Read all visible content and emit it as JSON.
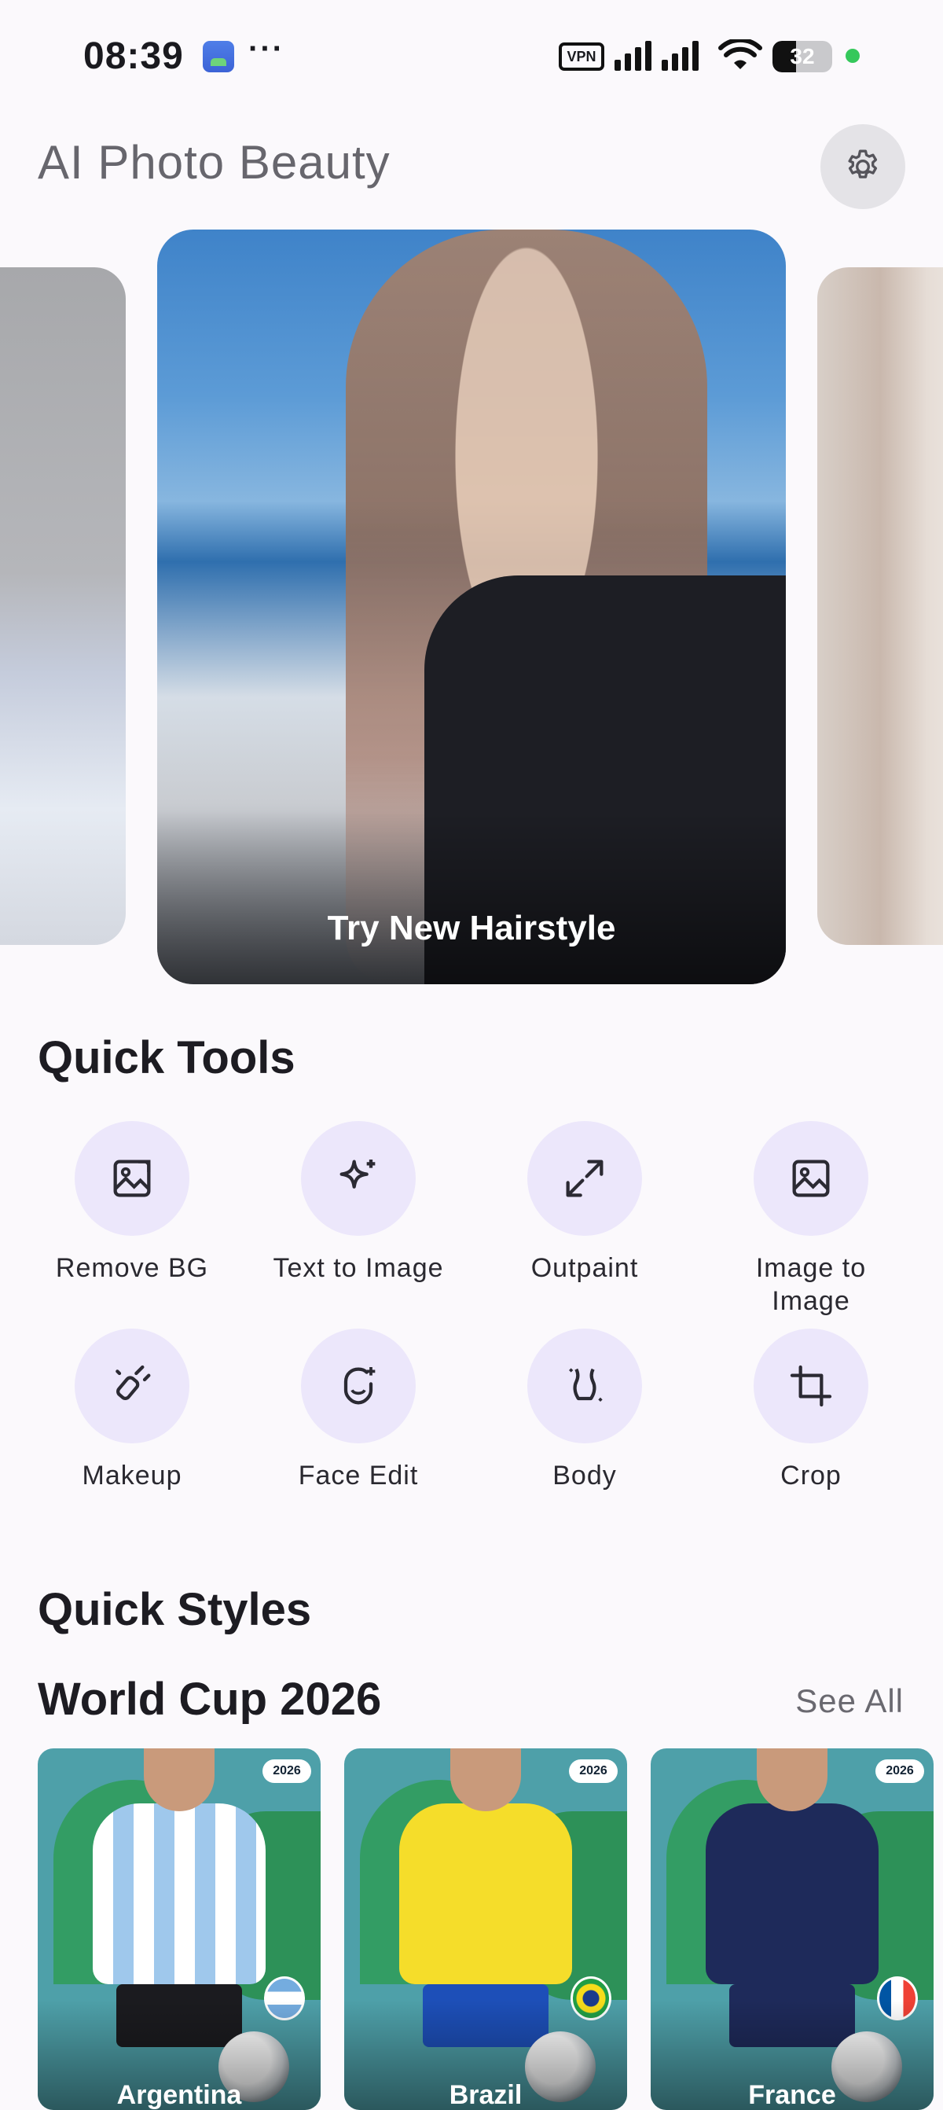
{
  "status_bar": {
    "time": "08:39",
    "more": "···",
    "vpn": "VPN",
    "battery": "32"
  },
  "header": {
    "title": "AI Photo Beauty",
    "settings_icon": "gear-icon"
  },
  "carousel": {
    "main_caption": "Try New Hairstyle"
  },
  "quick_tools": {
    "title": "Quick Tools",
    "items": [
      {
        "label": "Remove BG",
        "icon": "image-icon"
      },
      {
        "label": "Text to Image",
        "icon": "sparkle-icon"
      },
      {
        "label": "Outpaint",
        "icon": "expand-arrows-icon"
      },
      {
        "label": "Image to Image",
        "icon": "image-icon"
      },
      {
        "label": "Makeup",
        "icon": "makeup-brush-icon"
      },
      {
        "label": "Face Edit",
        "icon": "face-icon"
      },
      {
        "label": "Body",
        "icon": "body-icon"
      },
      {
        "label": "Crop",
        "icon": "crop-icon"
      }
    ]
  },
  "quick_styles": {
    "title": "Quick Styles",
    "section": "World Cup 2026",
    "see_all": "See All",
    "cards": [
      {
        "name": "Argentina",
        "badge": "2026",
        "shirt_color": "#bcd8f2",
        "shorts_color": "#1b1b1f",
        "flag_color": "#74acdf"
      },
      {
        "name": "Brazil",
        "badge": "2026",
        "shirt_color": "#f5dd2a",
        "shorts_color": "#1d4fb8",
        "flag_color": "#229e45"
      },
      {
        "name": "France",
        "badge": "2026",
        "shirt_color": "#1e2a5a",
        "shorts_color": "#1e2a5a",
        "flag_color": "#0055a4"
      }
    ]
  }
}
